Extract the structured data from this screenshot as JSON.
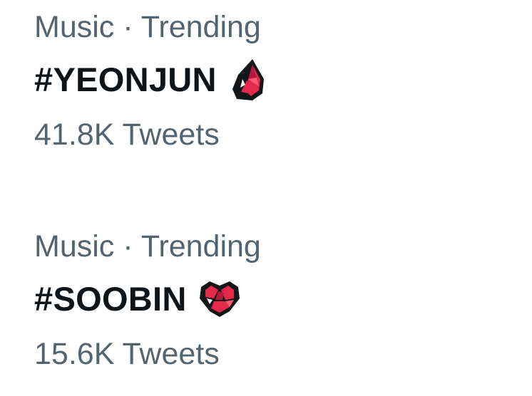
{
  "trends": [
    {
      "context": "Music · Trending",
      "title": "#YEONJUN",
      "hashflag_icon": "flame-gem-icon",
      "count": "41.8K Tweets"
    },
    {
      "context": "Music · Trending",
      "title": "#SOOBIN",
      "hashflag_icon": "heart-gem-icon",
      "count": "15.6K Tweets"
    }
  ],
  "colors": {
    "secondary_text": "#536471",
    "primary_text": "#0f1419",
    "hashflag_red": "#e5294b",
    "hashflag_outline": "#14171a"
  }
}
